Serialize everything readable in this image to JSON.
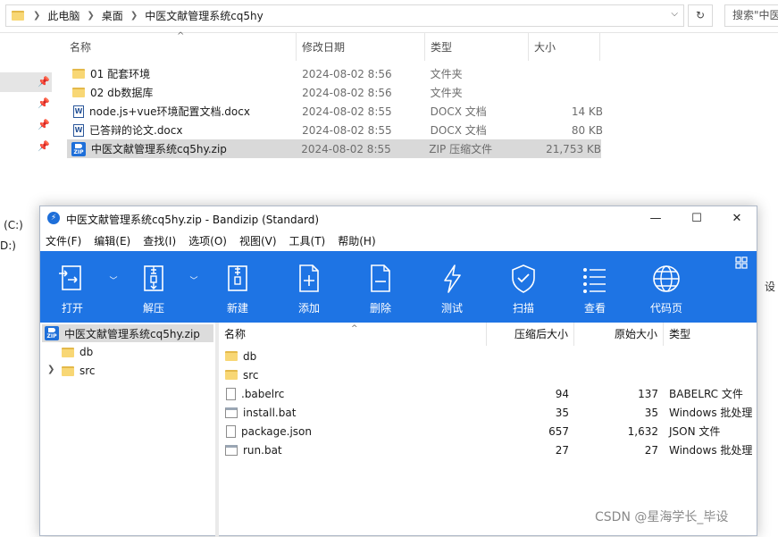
{
  "explorer": {
    "breadcrumb": [
      "此电脑",
      "桌面",
      "中医文献管理系统cq5hy"
    ],
    "search_placeholder": "搜索\"中医",
    "nav_partial": [
      "s (C:)",
      "D:)"
    ],
    "right_partial": "设",
    "columns": [
      "名称",
      "修改日期",
      "类型",
      "大小"
    ],
    "files": [
      {
        "name": "01  配套环境",
        "date": "2024-08-02 8:56",
        "type": "文件夹",
        "size": "",
        "icon": "folder-icon"
      },
      {
        "name": "02 db数据库",
        "date": "2024-08-02 8:56",
        "type": "文件夹",
        "size": "",
        "icon": "folder-icon"
      },
      {
        "name": "node.js+vue环境配置文档.docx",
        "date": "2024-08-02 8:55",
        "type": "DOCX 文档",
        "size": "14 KB",
        "icon": "word-doc-icon"
      },
      {
        "name": "已答辩的论文.docx",
        "date": "2024-08-02 8:55",
        "type": "DOCX 文档",
        "size": "80 KB",
        "icon": "word-doc-icon"
      },
      {
        "name": "中医文献管理系统cq5hy.zip",
        "date": "2024-08-02 8:55",
        "type": "ZIP 压缩文件",
        "size": "21,753 KB",
        "icon": "zip-icon",
        "selected": true
      }
    ]
  },
  "bandizip": {
    "title": "中医文献管理系统cq5hy.zip - Bandizip (Standard)",
    "menu": [
      "文件(F)",
      "编辑(E)",
      "查找(I)",
      "选项(O)",
      "视图(V)",
      "工具(T)",
      "帮助(H)"
    ],
    "toolbar": [
      {
        "label": "打开",
        "icon": "open-icon"
      },
      {
        "label": "解压",
        "icon": "extract-icon"
      },
      {
        "label": "新建",
        "icon": "new-archive-icon"
      },
      {
        "label": "添加",
        "icon": "add-icon"
      },
      {
        "label": "删除",
        "icon": "delete-icon"
      },
      {
        "label": "测试",
        "icon": "test-icon"
      },
      {
        "label": "扫描",
        "icon": "scan-icon"
      },
      {
        "label": "查看",
        "icon": "view-icon"
      },
      {
        "label": "代码页",
        "icon": "codepage-icon"
      }
    ],
    "tree": [
      "中医文献管理系统cq5hy.zip",
      "db",
      "src"
    ],
    "columns": [
      "名称",
      "压缩后大小",
      "原始大小",
      "类型"
    ],
    "files": [
      {
        "name": "db",
        "csize": "",
        "osize": "",
        "type": "",
        "icon": "folder-icon"
      },
      {
        "name": "src",
        "csize": "",
        "osize": "",
        "type": "",
        "icon": "folder-icon"
      },
      {
        "name": ".babelrc",
        "csize": "94",
        "osize": "137",
        "type": "BABELRC 文件",
        "icon": "file-icon"
      },
      {
        "name": "install.bat",
        "csize": "35",
        "osize": "35",
        "type": "Windows 批处理",
        "icon": "batch-file-icon"
      },
      {
        "name": "package.json",
        "csize": "657",
        "osize": "1,632",
        "type": "JSON 文件",
        "icon": "file-icon"
      },
      {
        "name": "run.bat",
        "csize": "27",
        "osize": "27",
        "type": "Windows 批处理",
        "icon": "batch-file-icon"
      }
    ]
  },
  "watermark": "CSDN @星海学长_毕设",
  "colors": {
    "toolbar_blue": "#1e74e4",
    "selection_gray": "#d9d9d9"
  }
}
